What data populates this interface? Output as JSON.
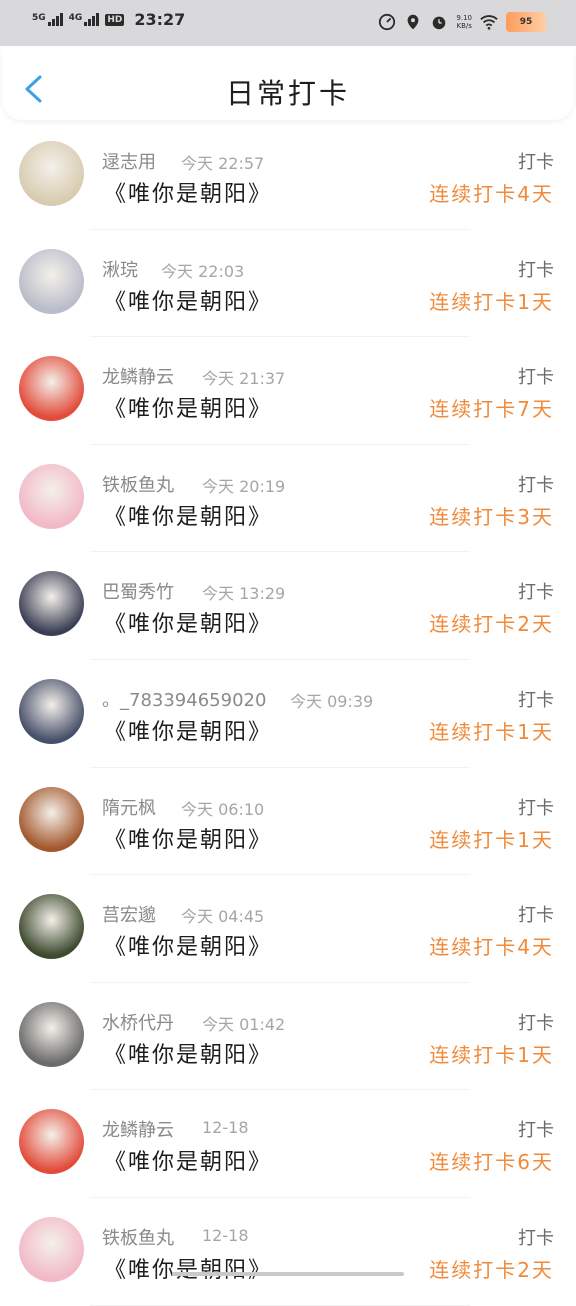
{
  "status_bar": {
    "sig1": "5G",
    "sig2": "4G",
    "hd": "HD",
    "time": "23:27",
    "net_speed_value": "9.10",
    "net_speed_unit": "KB/s",
    "battery": "95"
  },
  "header": {
    "title": "日常打卡"
  },
  "list": [
    {
      "name": "逯志用",
      "time": "今天 22:57",
      "book": "《唯你是朝阳》",
      "label": "打卡",
      "streak": "连续打卡4天",
      "avatar_color": "#d8ccb0"
    },
    {
      "name": "湫琓",
      "time": "今天 22:03",
      "book": "《唯你是朝阳》",
      "label": "打卡",
      "streak": "连续打卡1天",
      "avatar_color": "#b9bcc9"
    },
    {
      "name": "龙鳞静云",
      "time": "今天 21:37",
      "book": "《唯你是朝阳》",
      "label": "打卡",
      "streak": "连续打卡7天",
      "avatar_color": "#e24b3a"
    },
    {
      "name": "铁板鱼丸",
      "time": "今天 20:19",
      "book": "《唯你是朝阳》",
      "label": "打卡",
      "streak": "连续打卡3天",
      "avatar_color": "#f2b9c6"
    },
    {
      "name": "巴蜀秀竹",
      "time": "今天 13:29",
      "book": "《唯你是朝阳》",
      "label": "打卡",
      "streak": "连续打卡2天",
      "avatar_color": "#3b3f55"
    },
    {
      "name": "。_7833946590201...",
      "time": "今天 09:39",
      "book": "《唯你是朝阳》",
      "label": "打卡",
      "streak": "连续打卡1天",
      "avatar_color": "#47506b"
    },
    {
      "name": "隋元枫",
      "time": "今天 06:10",
      "book": "《唯你是朝阳》",
      "label": "打卡",
      "streak": "连续打卡1天",
      "avatar_color": "#a3582e"
    },
    {
      "name": "莒宏邈",
      "time": "今天 04:45",
      "book": "《唯你是朝阳》",
      "label": "打卡",
      "streak": "连续打卡4天",
      "avatar_color": "#3c4a2e"
    },
    {
      "name": "水桥代丹",
      "time": "今天 01:42",
      "book": "《唯你是朝阳》",
      "label": "打卡",
      "streak": "连续打卡1天",
      "avatar_color": "#6b6b6b"
    },
    {
      "name": "龙鳞静云",
      "time": "12-18",
      "book": "《唯你是朝阳》",
      "label": "打卡",
      "streak": "连续打卡6天",
      "avatar_color": "#e24b3a"
    },
    {
      "name": "铁板鱼丸",
      "time": "12-18",
      "book": "《唯你是朝阳》",
      "label": "打卡",
      "streak": "连续打卡2天",
      "avatar_color": "#f2b9c6"
    }
  ]
}
